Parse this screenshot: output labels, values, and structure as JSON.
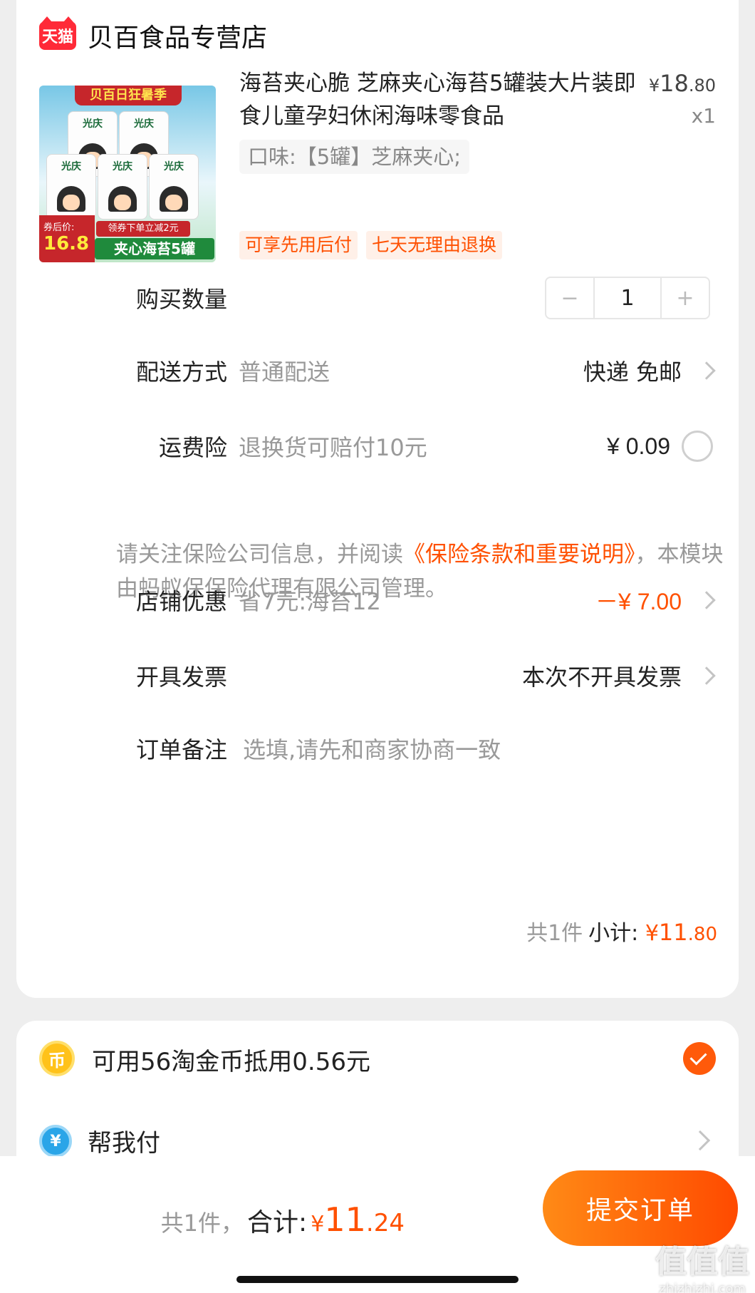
{
  "store": {
    "badge": "天猫",
    "name": "贝百食品专营店"
  },
  "product": {
    "image_banner": "贝百日狂暑季",
    "image_brand": "光庆",
    "image_price_label": "券后价:",
    "image_price": "16.8",
    "image_ribbon": "领券下单立减2元",
    "image_strip": "夹心海苔5罐",
    "title": "海苔夹心脆 芝麻夹心海苔5罐装大片装即食儿童孕妇休闲海味零食品",
    "price_currency": "¥",
    "price_int": "18",
    "price_dec": ".80",
    "quantity": "x1",
    "sku": "口味:【5罐】芝麻夹心;",
    "tags": [
      "可享先用后付",
      "七天无理由退换"
    ]
  },
  "order": {
    "qty_label": "购买数量",
    "qty_value": "1",
    "minus": "−",
    "plus": "+",
    "shipping_label": "配送方式",
    "shipping_sub": "普通配送",
    "shipping_value": "快递 免邮",
    "insurance_label": "运费险",
    "insurance_sub": "退换货可赔付10元",
    "insurance_value": "¥ 0.09",
    "notice_pre": "请关注保险公司信息，并阅读",
    "notice_link": "《保险条款和重要说明》",
    "notice_post": "，本模块由蚂蚁保保险代理有限公司管理。",
    "discount_label": "店铺优惠",
    "discount_sub": "省7元:海苔12",
    "discount_value": "－¥ 7.00",
    "invoice_label": "开具发票",
    "invoice_value": "本次不开具发票",
    "remark_label": "订单备注",
    "remark_placeholder": "选填,请先和商家协商一致",
    "subtotal_count": "共1件",
    "subtotal_label": "小计:",
    "subtotal_cur": "¥",
    "subtotal_int": "11",
    "subtotal_dec": ".80"
  },
  "payment": {
    "coin_icon": "币",
    "coin_text": "可用56淘金币抵用0.56元",
    "help_icon": "¥",
    "help_text": "帮我付"
  },
  "footer": {
    "count": "共1件，",
    "total_label": "合计:",
    "currency": "¥",
    "total_int": "11",
    "total_dec": ".24",
    "submit_label": "提交订单",
    "watermark_big": "值值值",
    "watermark_small": "zhizhizhi.com"
  },
  "colors": {
    "accent": "#ff5000",
    "tmall_red": "#ff2a38"
  }
}
